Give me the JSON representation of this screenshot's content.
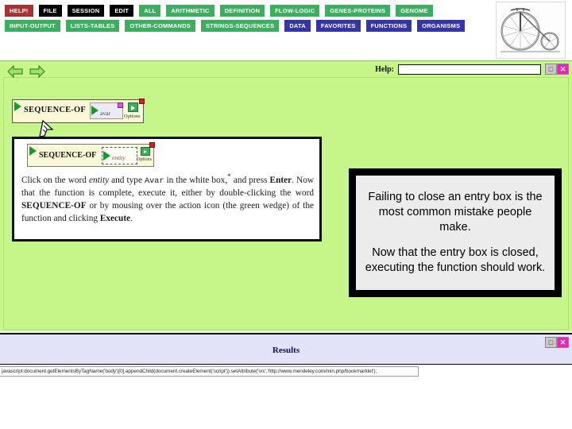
{
  "menubar": {
    "row1": [
      {
        "label": "HELP!",
        "style": "red"
      },
      {
        "label": "FILE",
        "style": "black"
      },
      {
        "label": "SESSION",
        "style": "black"
      },
      {
        "label": "EDIT",
        "style": "black"
      },
      {
        "label": "ALL",
        "style": "green"
      },
      {
        "label": "ARITHMETIC",
        "style": "green"
      },
      {
        "label": "DEFINITION",
        "style": "green"
      },
      {
        "label": "FLOW-LOGIC",
        "style": "green"
      },
      {
        "label": "GENES-PROTEINS",
        "style": "green"
      },
      {
        "label": "GENOME",
        "style": "green"
      }
    ],
    "row2": [
      {
        "label": "INPUT-OUTPUT",
        "style": "green"
      },
      {
        "label": "LISTS-TABLES",
        "style": "green"
      },
      {
        "label": "OTHER-COMMANDS",
        "style": "green"
      },
      {
        "label": "STRINGS-SEQUENCES",
        "style": "green"
      },
      {
        "label": "DATA",
        "style": "blue"
      },
      {
        "label": "FAVORITES",
        "style": "blue"
      },
      {
        "label": "FUNCTIONS",
        "style": "blue"
      },
      {
        "label": "ORGANISMS",
        "style": "blue"
      }
    ],
    "colors": {
      "red": "#a83232",
      "black": "#000000",
      "green": "#3bae5f",
      "blue": "#3535a8"
    }
  },
  "logo": {
    "name": "penny-farthing-bicycle"
  },
  "toolbar": {
    "back_arrow": "back-arrow",
    "forward_arrow": "forward-arrow",
    "help_label": "Help:",
    "help_value": "",
    "help_placeholder": "",
    "minimize_glyph": "□",
    "close_glyph": "✕"
  },
  "function_widget": {
    "name": "SEQUENCE-OF",
    "entry_value": "avar",
    "options_label": "Options",
    "action_icon": "green-wedge",
    "close_badge": "close",
    "entry_badge": "entry-close"
  },
  "figure": {
    "widget": {
      "name": "SEQUENCE-OF",
      "entry_value": "entity",
      "options_label": "Options"
    },
    "text_segments": [
      {
        "t": "Click on the word ",
        "style": "normal"
      },
      {
        "t": "entity",
        "style": "italic"
      },
      {
        "t": " and type ",
        "style": "normal"
      },
      {
        "t": "Avar",
        "style": "mono"
      },
      {
        "t": " in the white box,",
        "style": "normal"
      },
      {
        "t": "*",
        "style": "sup"
      },
      {
        "t": " and press ",
        "style": "normal"
      },
      {
        "t": "Enter",
        "style": "bold"
      },
      {
        "t": ". Now that the function is complete, execute it, either by double-clicking the word ",
        "style": "normal"
      },
      {
        "t": "SEQUENCE-OF",
        "style": "bold"
      },
      {
        "t": " or by mousing over the action icon (the green wedge) of the function and clicking ",
        "style": "normal"
      },
      {
        "t": "Execute",
        "style": "bold"
      },
      {
        "t": ".",
        "style": "normal"
      }
    ]
  },
  "callout": {
    "paragraph_1": "Failing to close an entry box  is the most common mistake people make.",
    "paragraph_2": "Now that the entry box is closed, executing the function should work."
  },
  "results": {
    "title": "Results",
    "minimize_glyph": "□",
    "close_glyph": "✕"
  },
  "statusbar": {
    "text": "javascript:document.getElementsByTagName('body')[0].appendChild(document.createElement('script')).setAttribute('src','http://www.mendeley.com/min.php/bookmarklet');"
  }
}
